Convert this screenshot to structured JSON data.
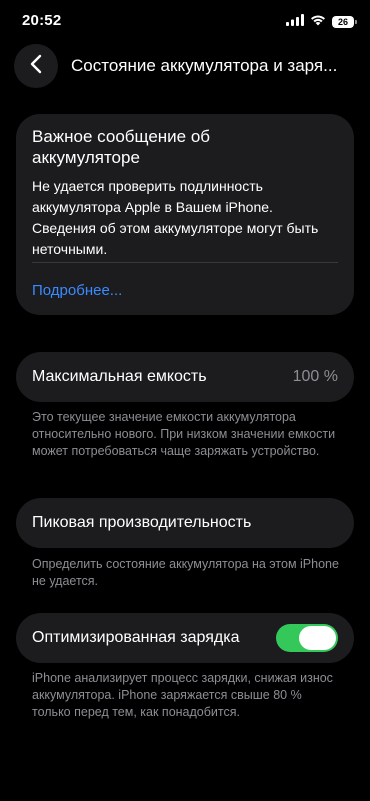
{
  "status_bar": {
    "time": "20:52",
    "battery_level": "26",
    "icons": [
      "cellular-signal-icon",
      "wifi-icon",
      "battery-icon"
    ]
  },
  "nav": {
    "back_icon": "chevron-left-icon",
    "title": "Состояние аккумулятора и заря..."
  },
  "important_message": {
    "title": "Важное сообщение об аккумуляторе",
    "body": "Не удается проверить подлинность аккумулятора Apple в Вашем iPhone. Сведения об этом аккумуляторе могут быть неточными.",
    "link": "Подробнее..."
  },
  "max_capacity": {
    "label": "Максимальная емкость",
    "value": "100 %",
    "footnote": "Это текущее значение емкости аккумулятора относительно нового. При низком значении емкости может потребоваться чаще заряжать устройство."
  },
  "peak_performance": {
    "label": "Пиковая производительность",
    "footnote": "Определить состояние аккумулятора на этом iPhone не удается."
  },
  "optimized_charging": {
    "label": "Оптимизированная зарядка",
    "enabled": true,
    "footnote": "iPhone анализирует процесс зарядки, снижая износ аккумулятора. iPhone заряжается свыше 80 % только перед тем, как понадобится."
  },
  "colors": {
    "background": "#000000",
    "card": "#1c1c1e",
    "link": "#3a8bff",
    "toggle_on": "#34c759",
    "secondary_text": "#8d8d93"
  }
}
